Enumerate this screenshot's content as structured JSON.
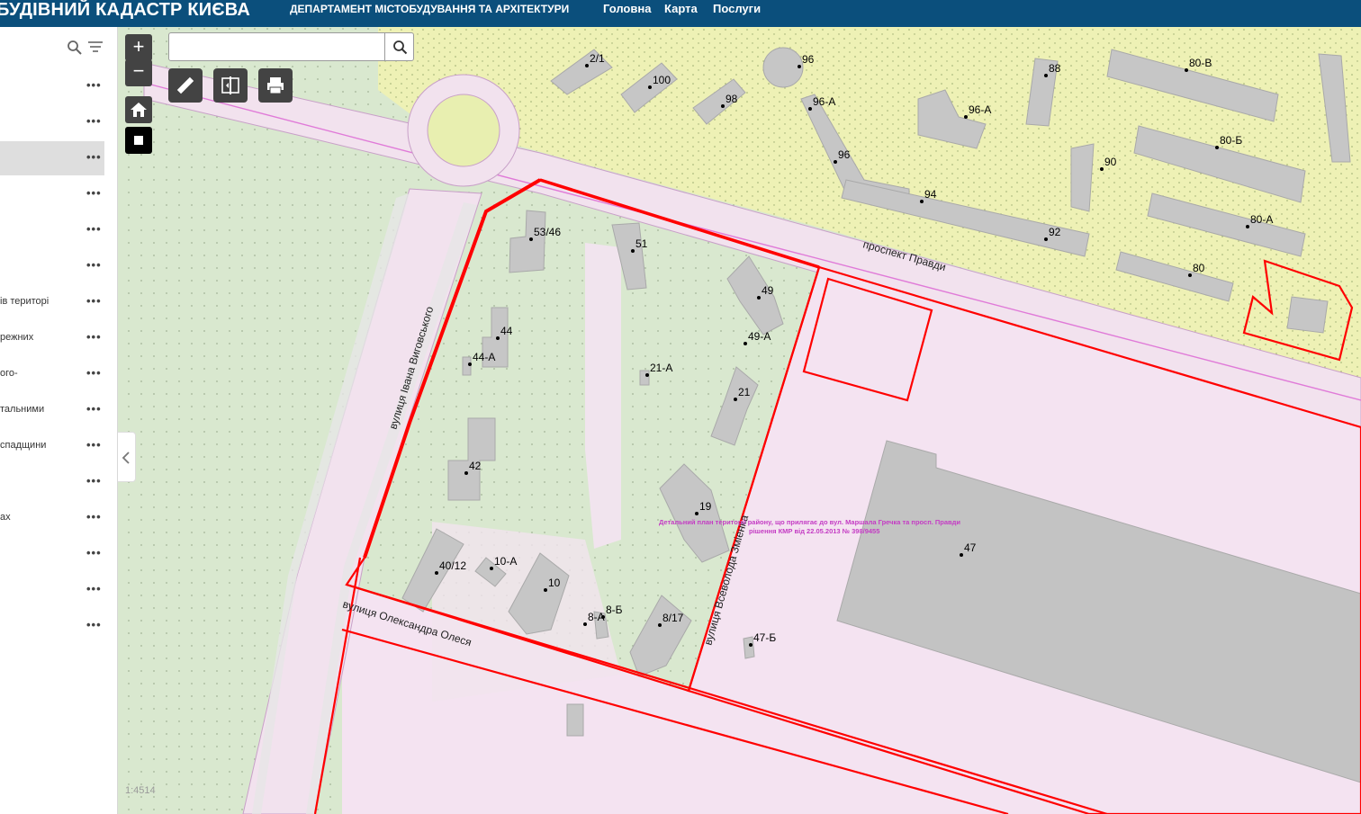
{
  "header": {
    "title": "БУДІВНИЙ КАДАСТР КИЄВА",
    "department": "ДЕПАРТАМЕНТ МІСТОБУДУВАННЯ ТА АРХІТЕКТУРИ",
    "nav": [
      "Головна",
      "Карта",
      "Послуги"
    ]
  },
  "sidebar": {
    "layers": [
      {
        "label": "",
        "active": false
      },
      {
        "label": "",
        "active": false
      },
      {
        "label": "",
        "active": true
      },
      {
        "label": "",
        "active": false
      },
      {
        "label": "",
        "active": false
      },
      {
        "label": "",
        "active": false
      },
      {
        "label": "ів територі",
        "active": false
      },
      {
        "label": "режних",
        "active": false
      },
      {
        "label": "ого-",
        "active": false
      },
      {
        "label": "тальними",
        "active": false
      },
      {
        "label": "спадщини",
        "active": false
      },
      {
        "label": "",
        "active": false
      },
      {
        "label": "ах",
        "active": false
      },
      {
        "label": "",
        "active": false
      },
      {
        "label": "",
        "active": false
      },
      {
        "label": "",
        "active": false
      }
    ],
    "menu_glyph": "•••"
  },
  "map": {
    "search_placeholder": "",
    "zoom_in": "+",
    "zoom_out": "−",
    "scale": "1:4514",
    "streets": {
      "pravdy": "проспект Правди",
      "vyhovskoho": "вулиця Івана Виговського",
      "olesya": "вулиця Олександра Олеся",
      "zhmenka": "вулиця Всеволода Зміенка"
    },
    "plan_note": {
      "line1": "Детальний план території району, що прилягає до вул. Маршала Гречка та просп. Правди",
      "line2": "рішення КМР від 22.05.2013 № 398/9455"
    },
    "buildings": [
      "2/1",
      "100",
      "98",
      "96",
      "96-А",
      "96-А",
      "96",
      "94",
      "92",
      "88",
      "90",
      "80-В",
      "80-Б",
      "80-А",
      "80",
      "53/46",
      "51",
      "49",
      "49-А",
      "44",
      "44-А",
      "21-А",
      "21",
      "42",
      "19",
      "47",
      "40/12",
      "10-А",
      "10",
      "8-А",
      "8-Б",
      "8/17",
      "47-Б"
    ]
  },
  "colors": {
    "header_bg": "#0b4f7c",
    "parcel_outline": "#ff0000",
    "green_zone": "#d9e8cf",
    "pink_zone": "#f4e3f1",
    "yellow_zone": "#eef1b5",
    "building": "#c9c9c9",
    "note_text": "#c43cc4"
  },
  "icons": {
    "search": "search-icon",
    "filter": "filter-icon",
    "home": "home-icon",
    "measure": "ruler-icon",
    "swipe": "swipe-icon",
    "print": "print-icon",
    "stop": "stop-icon",
    "collapse": "chevron-left-icon"
  }
}
